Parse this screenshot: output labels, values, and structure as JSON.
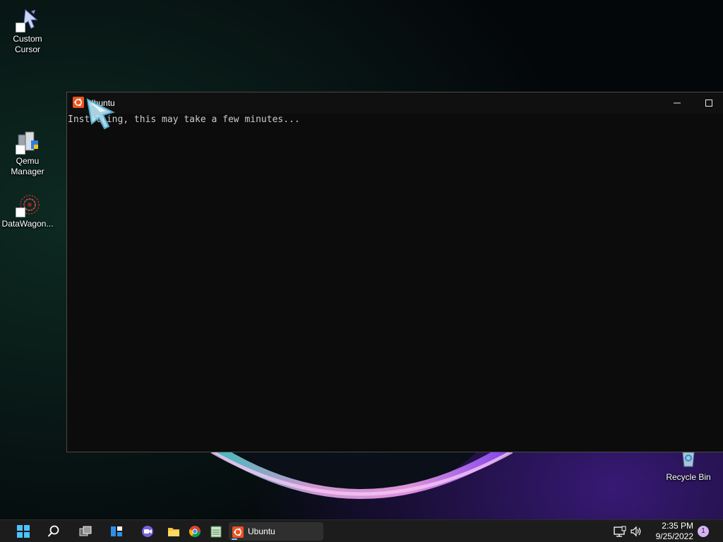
{
  "desktop": {
    "icons": [
      {
        "label_line1": "Custom",
        "label_line2": "Cursor",
        "icon": "custom-cursor-icon"
      },
      {
        "label_line1": "Qemu",
        "label_line2": "Manager",
        "icon": "qemu-manager-icon"
      },
      {
        "label_line1": "DataWagon...",
        "label_line2": "",
        "icon": "datawagon-icon"
      },
      {
        "label_line1": "Recycle Bin",
        "label_line2": "",
        "icon": "recycle-bin-icon"
      }
    ]
  },
  "window": {
    "title": "Ubuntu",
    "icon": "ubuntu-icon",
    "console_text": "Installing, this may take a few minutes..."
  },
  "taskbar": {
    "items": [
      "start-icon",
      "search-icon",
      "task-view-icon",
      "widgets-icon",
      "chat-icon",
      "file-explorer-icon",
      "chrome-icon",
      "notepad-icon"
    ],
    "active_app": {
      "label": "Ubuntu",
      "icon": "ubuntu-icon"
    },
    "tray": {
      "network_icon": "network-icon",
      "volume_icon": "volume-icon",
      "time": "2:35 PM",
      "date": "9/25/2022",
      "notification_count": "1"
    }
  },
  "colors": {
    "console_bg": "#0c0c0c",
    "console_text": "#cccccc",
    "taskbar_bg": "#1c1c1c",
    "ubuntu_orange": "#e95420",
    "badge": "#d6b3f4"
  }
}
